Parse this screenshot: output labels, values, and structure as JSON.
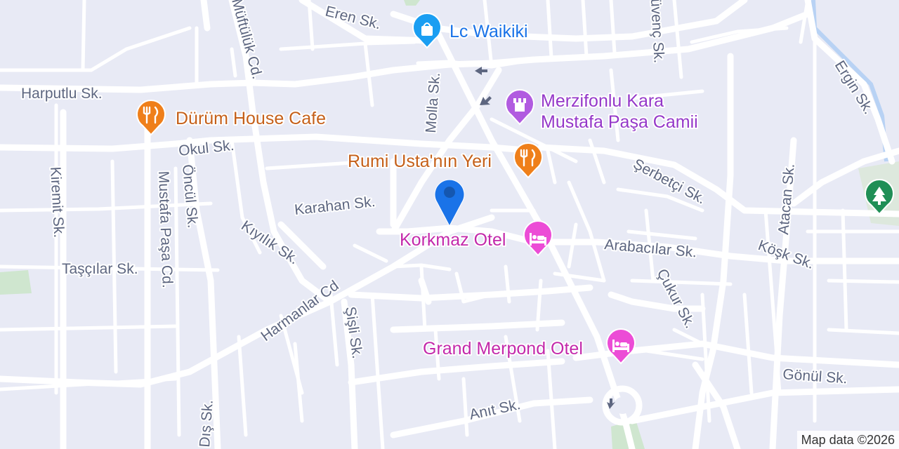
{
  "map": {
    "colors": {
      "background": "#e8eaf5",
      "road": "#ffffff",
      "park": "#cfe6cf",
      "water": "#b8d2f4",
      "street_label": "#5d6680",
      "shop": "#1a9ef2",
      "restaurant": "#ef7f1a",
      "mosque": "#b15be0",
      "hotel": "#ec4cd6",
      "park_poi": "#1f8f56",
      "location_marker": "#1a73e8"
    },
    "streets": [
      "Eren Sk.",
      "Müftülük Cd.",
      "Harputlu Sk.",
      "Molla Sk.",
      "Güvenç Sk.",
      "Okul Sk.",
      "Ergin Sk.",
      "Öncül Sk.",
      "Kiremit Sk.",
      "Mustafa Paşa Cd.",
      "Karahan Sk.",
      "Şerbetçi Sk.",
      "Atacan Sk.",
      "Kıyılık Sk.",
      "Arabacılar Sk.",
      "Köşk Sk.",
      "Taşçılar Sk.",
      "Harmanlar Cd",
      "Çukur Sk.",
      "Şişli Sk.",
      "Gönül Sk.",
      "Anıt Sk.",
      "Dış Sk."
    ],
    "pois": [
      {
        "name": "Lc Waikiki",
        "icon": "shopping-bag-icon",
        "category": "shop"
      },
      {
        "name": "Dürüm House Cafe",
        "icon": "fork-knife-icon",
        "category": "restaurant"
      },
      {
        "name": "Merzifonlu Kara",
        "name_line2": "Mustafa Paşa Camii",
        "icon": "mosque-icon",
        "category": "mosque"
      },
      {
        "name": "Rumi Usta'nın Yeri",
        "icon": "fork-knife-icon",
        "category": "restaurant"
      },
      {
        "name": "Korkmaz Otel",
        "icon": "bed-icon",
        "category": "hotel"
      },
      {
        "name": "Grand Merpond Otel",
        "icon": "bed-icon",
        "category": "hotel"
      },
      {
        "name": "",
        "icon": "tree-icon",
        "category": "park"
      }
    ],
    "attribution": "Map data ©2026"
  }
}
